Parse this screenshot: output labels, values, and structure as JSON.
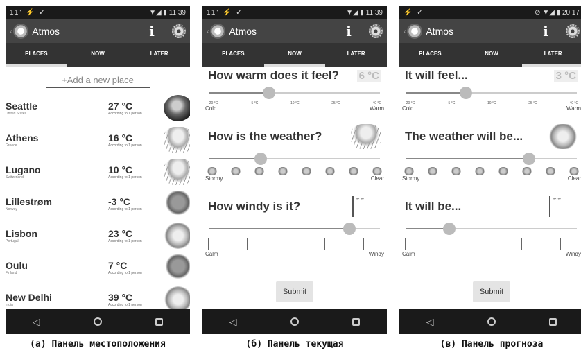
{
  "app": {
    "title": "Atmos"
  },
  "tabs": [
    "PLACES",
    "NOW",
    "LATER"
  ],
  "p1": {
    "status": {
      "left": "11' ⚡ ✓",
      "right": "▼◢ ▮ 11:39"
    },
    "add_placeholder": "+Add a new place",
    "places": [
      {
        "name": "Seattle",
        "country": "United States",
        "temp": "27 °C",
        "note": "According to 1 person",
        "icon": "glass-globe-icon"
      },
      {
        "name": "Athens",
        "country": "Greece",
        "temp": "16 °C",
        "note": "According to 1 person",
        "icon": "rain-cloud-icon"
      },
      {
        "name": "Lugano",
        "country": "Switzerland",
        "temp": "10 °C",
        "note": "According to 1 person",
        "icon": "rain-cloud-icon"
      },
      {
        "name": "Lillestrøm",
        "country": "Norway",
        "temp": "-3 °C",
        "note": "According to 1 person",
        "icon": "cloud-icon"
      },
      {
        "name": "Lisbon",
        "country": "Portugal",
        "temp": "23 °C",
        "note": "According to 1 person",
        "icon": "sun-icon"
      },
      {
        "name": "Oulu",
        "country": "Finland",
        "temp": "7 °C",
        "note": "According to 1 person",
        "icon": "cloud-icon"
      },
      {
        "name": "New Delhi",
        "country": "India",
        "temp": "39 °C",
        "note": "According to 1 person",
        "icon": "sun-icon"
      }
    ]
  },
  "p2": {
    "status": {
      "left": "11' ⚡ ✓",
      "right": "▼◢ ▮ 11:39"
    },
    "q1": {
      "title": "How warm does it feel?",
      "value": "6 °C",
      "level": 0.35
    },
    "ticks": [
      "-20 °C",
      "-5 °C",
      "10 °C",
      "25 °C",
      "40 °C"
    ],
    "q1_ends": {
      "left": "Cold",
      "right": "Warm"
    },
    "q2": {
      "title": "How is the weather?",
      "level": 0.3
    },
    "q2_ends": {
      "left": "Stormy",
      "right": "Clear"
    },
    "q3": {
      "title": "How windy is it?",
      "level": 0.82
    },
    "q3_ends": {
      "left": "Calm",
      "right": "Windy"
    },
    "submit": "Submit"
  },
  "p3": {
    "status": {
      "left": "⚡ ✓",
      "right": "⊘ ▼◢ ▮ 20:17"
    },
    "q1": {
      "title": "It will feel...",
      "value": "3 °C",
      "level": 0.35
    },
    "ticks": [
      "-20 °C",
      "-5 °C",
      "10 °C",
      "25 °C",
      "40 °C"
    ],
    "q1_ends": {
      "left": "Cold",
      "right": "Warm"
    },
    "q2": {
      "title": "The weather will be...",
      "level": 0.72
    },
    "q2_ends": {
      "left": "Stormy",
      "right": "Clear"
    },
    "q3": {
      "title": "It will be...",
      "level": 0.25
    },
    "q3_ends": {
      "left": "Calm",
      "right": "Windy"
    },
    "submit": "Submit"
  },
  "captions": [
    "(a) Панель местоположения",
    "(б) Панель текущая",
    "(в) Панель прогноза"
  ]
}
